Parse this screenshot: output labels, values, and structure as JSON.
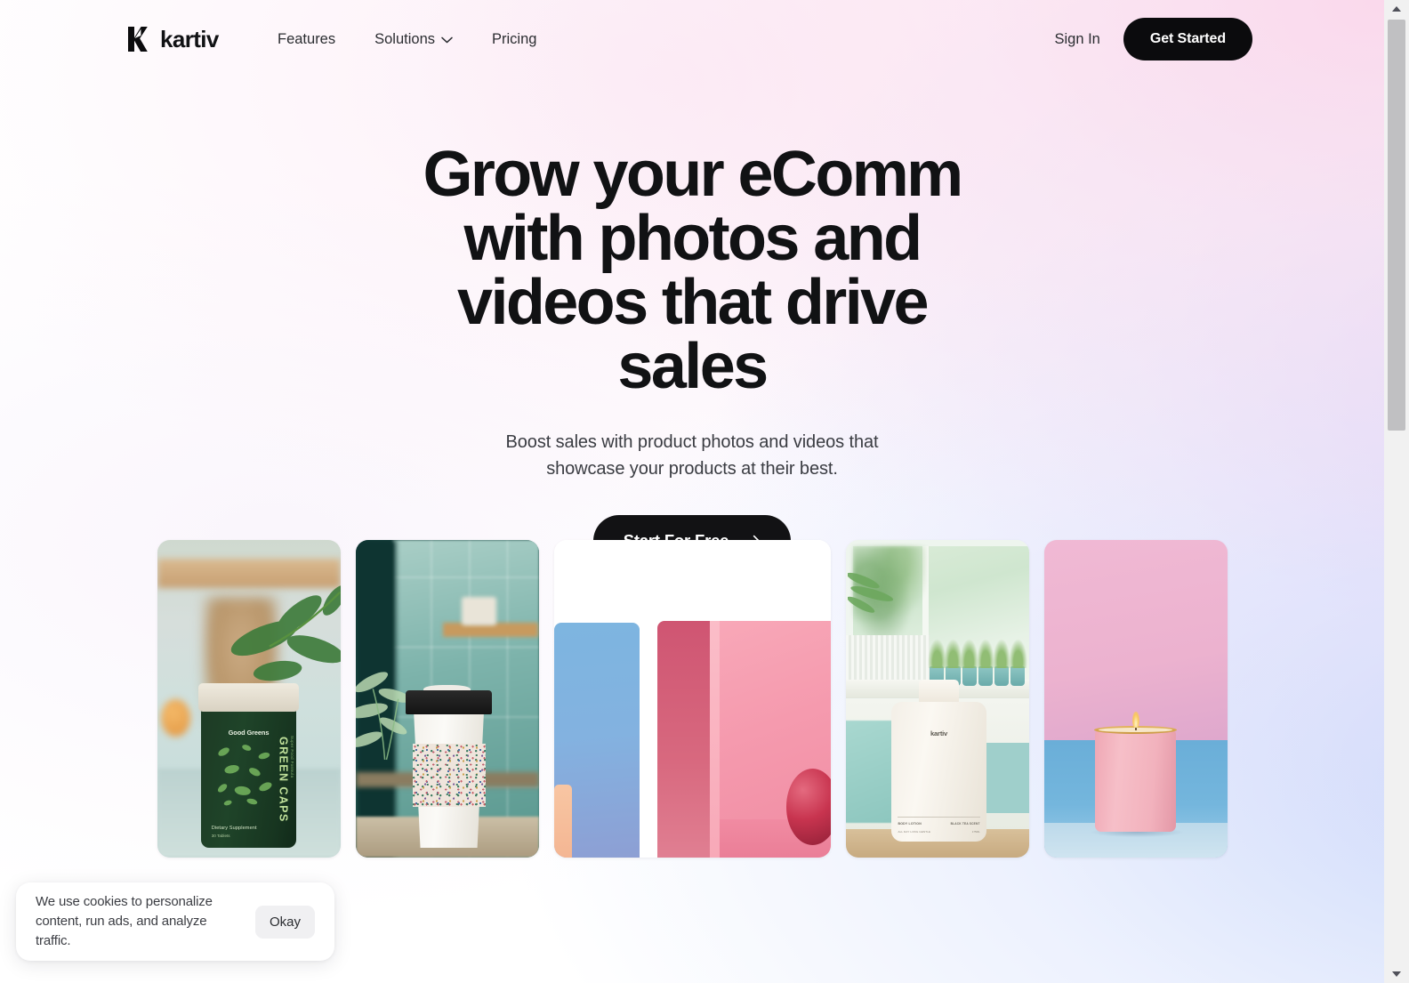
{
  "header": {
    "brand": {
      "name": "kartiv",
      "logo_icon": "kartiv-k-mark"
    },
    "nav": [
      {
        "label": "Features",
        "has_dropdown": false
      },
      {
        "label": "Solutions",
        "has_dropdown": true
      },
      {
        "label": "Pricing",
        "has_dropdown": false
      }
    ],
    "sign_in_label": "Sign In",
    "get_started_label": "Get Started"
  },
  "hero": {
    "headline": "Grow your eComm with photos and videos that drive sales",
    "subhead": "Boost sales with product photos and videos that showcase your products at their best.",
    "cta_label": "Start For Free",
    "cta_icon": "arrow-right-icon"
  },
  "gallery": {
    "items": [
      {
        "id": "green-caps-supplement",
        "alt": "Green supplement jar on a kitchen counter with a plant",
        "labels": {
          "brand": "Good Greens",
          "vertical": "GREEN CAPS",
          "vertical_small": "Super Food Formula",
          "sub": "Dietary Supplement",
          "sub2": "30 Tablets"
        }
      },
      {
        "id": "coffee-cup",
        "alt": "Takeaway coffee cup with patterned sleeve by a window",
        "labels": {}
      },
      {
        "id": "abstract-blocks",
        "alt": "Abstract blue and pink geometric blocks with a red sphere",
        "labels": {}
      },
      {
        "id": "body-lotion-bottle",
        "alt": "Kartiv body lotion bottle in a bright bathroom",
        "labels": {
          "brand": "kartiv",
          "line1": "BODY LOTION",
          "line2": "BLACK TEA SCENT",
          "line3": "ALL DAY LONG GENTLE",
          "line4": "175ML"
        }
      },
      {
        "id": "pink-candle",
        "alt": "Lit pink candle on a blue surface with pink backdrop",
        "labels": {}
      }
    ]
  },
  "cookie_banner": {
    "text": "We use cookies to personalize content, run ads, and analyze traffic.",
    "accept_label": "Okay"
  },
  "scrollbar": {
    "up_icon": "triangle-up-icon",
    "down_icon": "triangle-down-icon"
  },
  "colors": {
    "ink": "#111214",
    "button_dark": "#0b0b0d",
    "page_white": "#ffffff",
    "wash_pink": "#fad7eb",
    "wash_lavender": "#ded4f8",
    "wash_blue": "#c8d6fa"
  }
}
